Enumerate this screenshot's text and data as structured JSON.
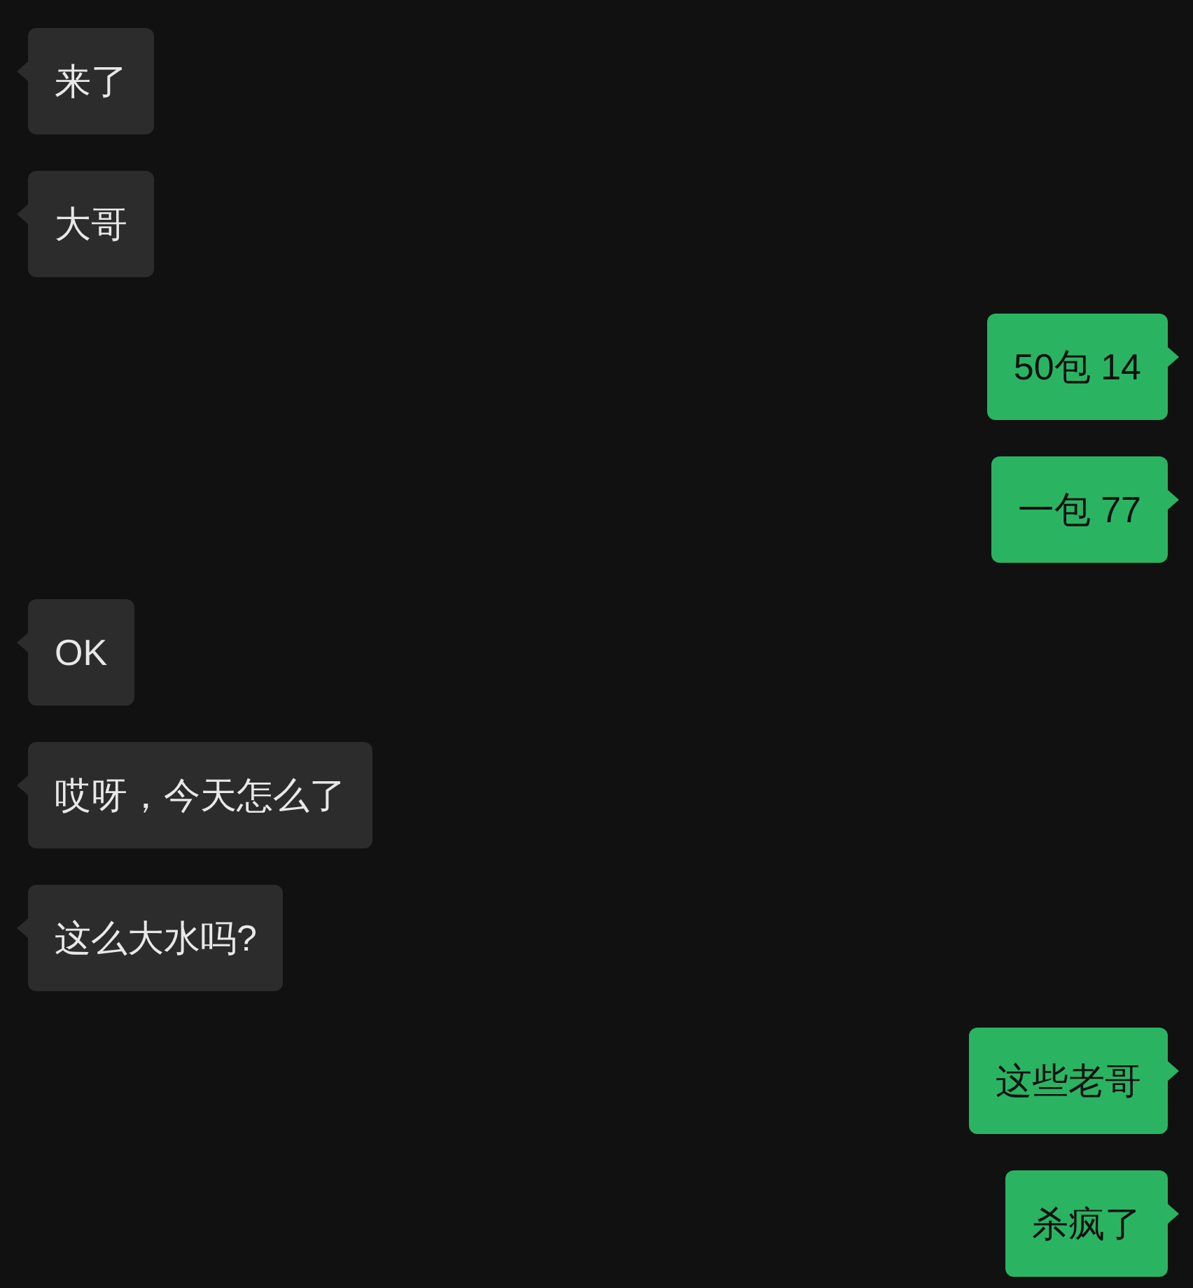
{
  "messages": [
    {
      "kind": "received",
      "text": "来了"
    },
    {
      "kind": "received",
      "text": "大哥"
    },
    {
      "kind": "sent",
      "text": "50包 14"
    },
    {
      "kind": "sent",
      "text": "一包 77"
    },
    {
      "kind": "received",
      "text": "OK"
    },
    {
      "kind": "received",
      "text": "哎呀，今天怎么了"
    },
    {
      "kind": "received",
      "text": "这么大水吗?"
    },
    {
      "kind": "sent",
      "text": "这些老哥"
    },
    {
      "kind": "sent",
      "text": "杀疯了"
    }
  ]
}
